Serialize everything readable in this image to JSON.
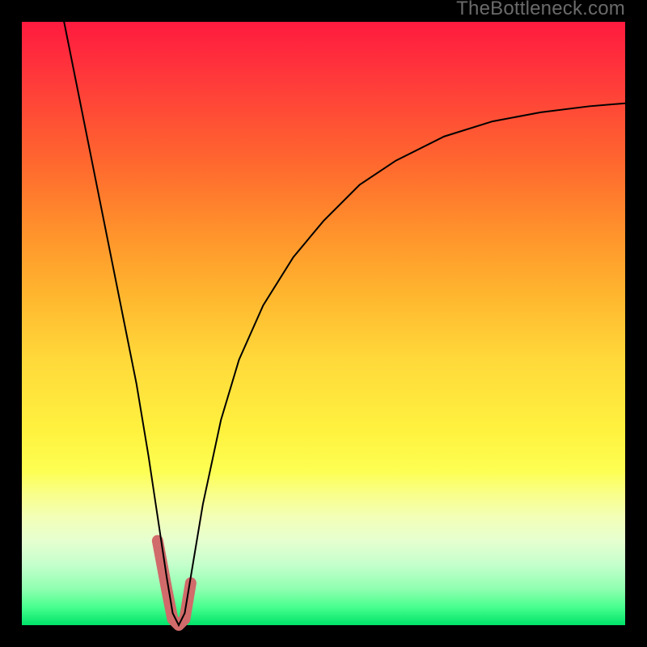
{
  "watermark": "TheBottleneck.com",
  "chart_data": {
    "type": "line",
    "title": "",
    "xlabel": "",
    "ylabel": "",
    "xlim": [
      0,
      100
    ],
    "ylim": [
      0,
      100
    ],
    "grid": false,
    "legend": false,
    "series": [
      {
        "name": "bottleneck-curve",
        "x": [
          7,
          9,
          11,
          13,
          15,
          17,
          19,
          21,
          22.5,
          24,
          25,
          26,
          27,
          28,
          30,
          33,
          36,
          40,
          45,
          50,
          56,
          62,
          70,
          78,
          86,
          94,
          100
        ],
        "y": [
          100,
          90,
          80,
          70,
          60,
          50,
          40,
          28,
          18,
          8,
          2,
          0,
          2,
          8,
          20,
          34,
          44,
          53,
          61,
          67,
          73,
          77,
          81,
          83.5,
          85,
          86,
          86.5
        ]
      }
    ],
    "min_segment": {
      "x": [
        22.5,
        24,
        25,
        26,
        27,
        28
      ],
      "y": [
        14,
        6,
        1,
        0,
        1,
        7
      ]
    },
    "colors": {
      "curve": "#000000",
      "min_highlight": "#d16a6a",
      "gradient_top": "#ff1a3f",
      "gradient_bottom": "#00e36a"
    }
  }
}
